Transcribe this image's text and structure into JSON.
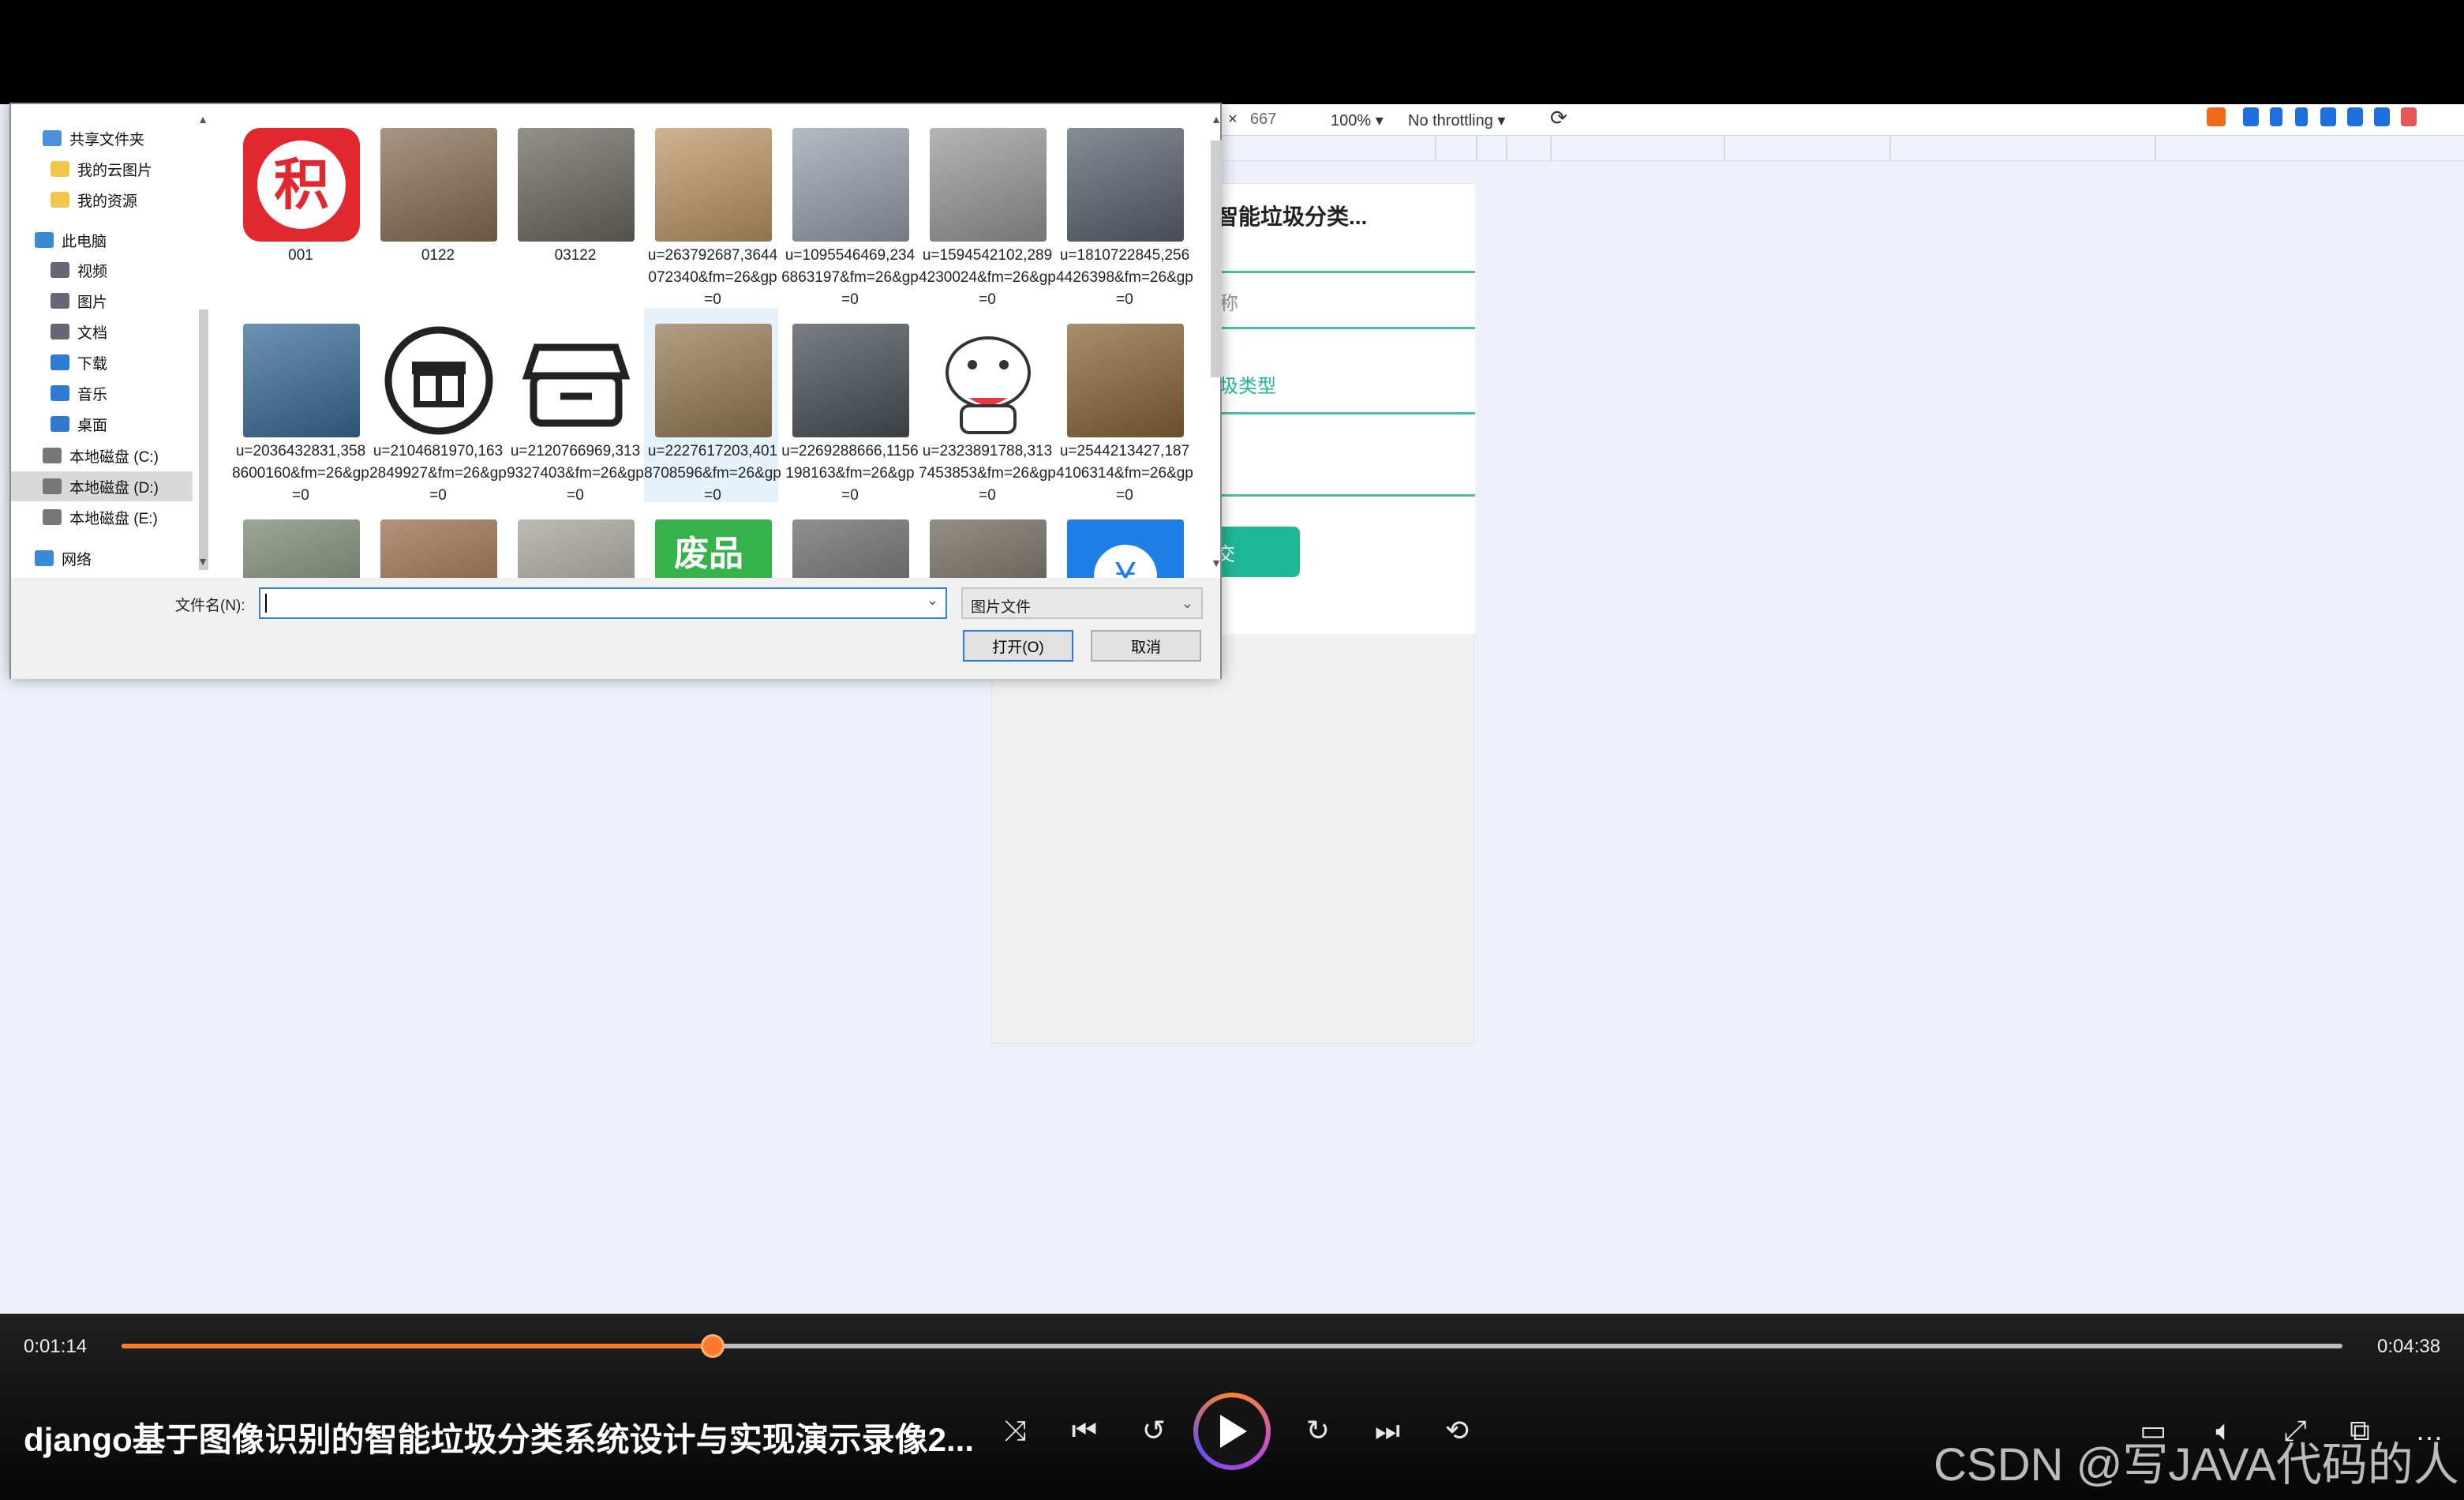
{
  "browser": {
    "devtools": {
      "height_value": "667",
      "zoom": "100%",
      "throttling": "No throttling"
    },
    "page": {
      "title": "智能垃圾分类...",
      "field1_placeholder": "称",
      "field2_value": "圾类型",
      "submit_label": "交"
    }
  },
  "dialog": {
    "nav": [
      {
        "label": "共享文件夹",
        "icon": "share-folder-icon",
        "color": "#4a8fd9"
      },
      {
        "label": "我的云图片",
        "icon": "folder-icon",
        "color": "#f2c84b"
      },
      {
        "label": "我的资源",
        "icon": "folder-icon",
        "color": "#f2c84b"
      },
      {
        "label": "此电脑",
        "icon": "computer-icon",
        "color": "#3a8ad8"
      },
      {
        "label": "视频",
        "icon": "video-icon",
        "color": "#667"
      },
      {
        "label": "图片",
        "icon": "picture-icon",
        "color": "#667"
      },
      {
        "label": "文档",
        "icon": "document-icon",
        "color": "#667"
      },
      {
        "label": "下载",
        "icon": "download-icon",
        "color": "#2f7ad4"
      },
      {
        "label": "音乐",
        "icon": "music-icon",
        "color": "#2f7ad4"
      },
      {
        "label": "桌面",
        "icon": "desktop-icon",
        "color": "#2f7ad4"
      },
      {
        "label": "本地磁盘 (C:)",
        "icon": "drive-icon",
        "color": "#777"
      },
      {
        "label": "本地磁盘 (D:)",
        "icon": "drive-icon",
        "color": "#777"
      },
      {
        "label": "本地磁盘 (E:)",
        "icon": "drive-icon",
        "color": "#777"
      },
      {
        "label": "网络",
        "icon": "network-icon",
        "color": "#3a8ad8"
      }
    ],
    "files": [
      {
        "name": "001",
        "thumb": "#e0282e",
        "kind": "logo-ji"
      },
      {
        "name": "0122",
        "thumb": "#8b7358"
      },
      {
        "name": "03122",
        "thumb": "#6d6d62"
      },
      {
        "name": "u=263792687,3644072340&fm=26&gp=0",
        "thumb": "#c09a6a"
      },
      {
        "name": "u=1095546469,2346863197&fm=26&gp=0",
        "thumb": "#9aa4b0"
      },
      {
        "name": "u=1594542102,2894230024&fm=26&gp=0",
        "thumb": "#9c9c9c"
      },
      {
        "name": "u=1810722845,2564426398&fm=26&gp=0",
        "thumb": "#5e6670"
      },
      {
        "name": "u=2036432831,3588600160&fm=26&gp=0",
        "thumb": "#3b6e9c"
      },
      {
        "name": "u=2104681970,1632849927&fm=26&gp=0",
        "thumb": "#ffffff",
        "kind": "gift"
      },
      {
        "name": "u=2120766969,3139327403&fm=26&gp=0",
        "thumb": "#ffffff",
        "kind": "box"
      },
      {
        "name": "u=2227617203,4018708596&fm=26&gp=0",
        "thumb": "#9b7e5a"
      },
      {
        "name": "u=2269288666,1156198163&fm=26&gp=0",
        "thumb": "#4c5359"
      },
      {
        "name": "u=2323891788,3137453853&fm=26&gp=0",
        "thumb": "#ffffff",
        "kind": "cat"
      },
      {
        "name": "u=2544213427,1874106314&fm=26&gp=0",
        "thumb": "#8a6a3c"
      },
      {
        "name": "",
        "thumb": "#7c8a74"
      },
      {
        "name": "",
        "thumb": "#9c6e4e"
      },
      {
        "name": "",
        "thumb": "#a7a59a"
      },
      {
        "name": "",
        "thumb": "#35b34a",
        "kind": "feipin"
      },
      {
        "name": "",
        "thumb": "#6b6b6b"
      },
      {
        "name": "",
        "thumb": "#706a5e"
      },
      {
        "name": "",
        "thumb": "#1f7fe6",
        "kind": "blue-circle"
      }
    ],
    "filename_label": "文件名(N):",
    "filename_value": "",
    "filetype": "图片文件",
    "open_button": "打开(O)",
    "cancel_button": "取消",
    "logo_ji": "积",
    "logo_feipin": "废品",
    "logo_yen": "¥"
  },
  "player": {
    "current_time": "0:01:14",
    "total_time": "0:04:38",
    "progress_fraction": 0.266,
    "title": "django基于图像识别的智能垃圾分类系统设计与实现演示录像2...",
    "controls": [
      {
        "name": "shuffle-icon",
        "glyph": "⤨"
      },
      {
        "name": "previous-icon",
        "glyph": "⏮"
      },
      {
        "name": "rewind-10-icon",
        "glyph": "↺"
      },
      {
        "name": "forward-30-icon",
        "glyph": "↻"
      },
      {
        "name": "next-icon",
        "glyph": "⏭"
      },
      {
        "name": "repeat-off-icon",
        "glyph": "⟲"
      }
    ],
    "watermark": "CSDN @写JAVA代码的人"
  }
}
